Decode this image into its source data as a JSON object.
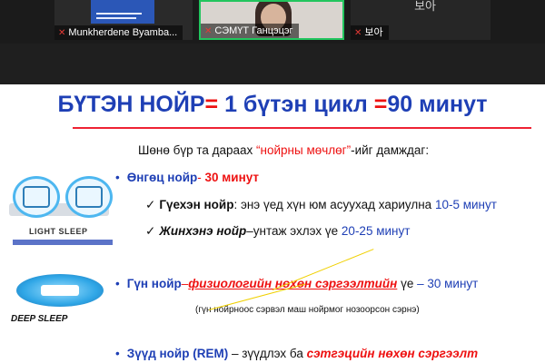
{
  "call": {
    "participants": [
      {
        "name": "Munkherdene Byamba...",
        "muted": true
      },
      {
        "name": "СЭМҮТ Ганцэцэг",
        "muted": true,
        "active_speaker": true
      },
      {
        "name": "보아",
        "muted": true
      }
    ],
    "corner_label": "보아",
    "active_color": "#22c55e"
  },
  "slide": {
    "title": {
      "part1": "БҮТЭН НОЙР",
      "eq1": "=",
      "part2": " 1 бүтэн цикл ",
      "eq2": "=",
      "part3": "90 минут"
    },
    "intro": {
      "pre": "Шөнө бүр та  дараах ",
      "highlight": "“нойрны мөчлөг”",
      "post": "-ийг дамждаг:"
    },
    "stage1": {
      "label": "Өнгөц нойр",
      "sep": "- ",
      "value": "30 минут"
    },
    "stage1a": {
      "label": "Гүехэн нойр",
      "desc": ": энэ үед хүн юм асуухад хариулна ",
      "value": "10-5 минут"
    },
    "stage1b": {
      "label": "Жинхэнэ нойр",
      "desc": "–унтаж эхлэх үе  ",
      "value": "20-25 минут"
    },
    "stage2": {
      "label": "Гүн нойр",
      "dash": "–",
      "desc": "физиологийн нөхөн сэргээлтийн",
      "desc2": " үе ",
      "value": "– 30 минут"
    },
    "stage2_note": "(гүн нойрноос сэрвэл маш нойрмог нозоорсон сэрнэ)",
    "stage3": {
      "label": "Зүүд нойр (REM)",
      "desc": " – зүүдлэх ба ",
      "value": "сэтгэцийн нөхөн сэргээлт"
    },
    "illustrations": {
      "light": "LIGHT SLEEP",
      "deep": "DEEP SLEEP"
    },
    "colors": {
      "title_blue": "#1e3fb5",
      "accent_red": "#e11111"
    }
  }
}
